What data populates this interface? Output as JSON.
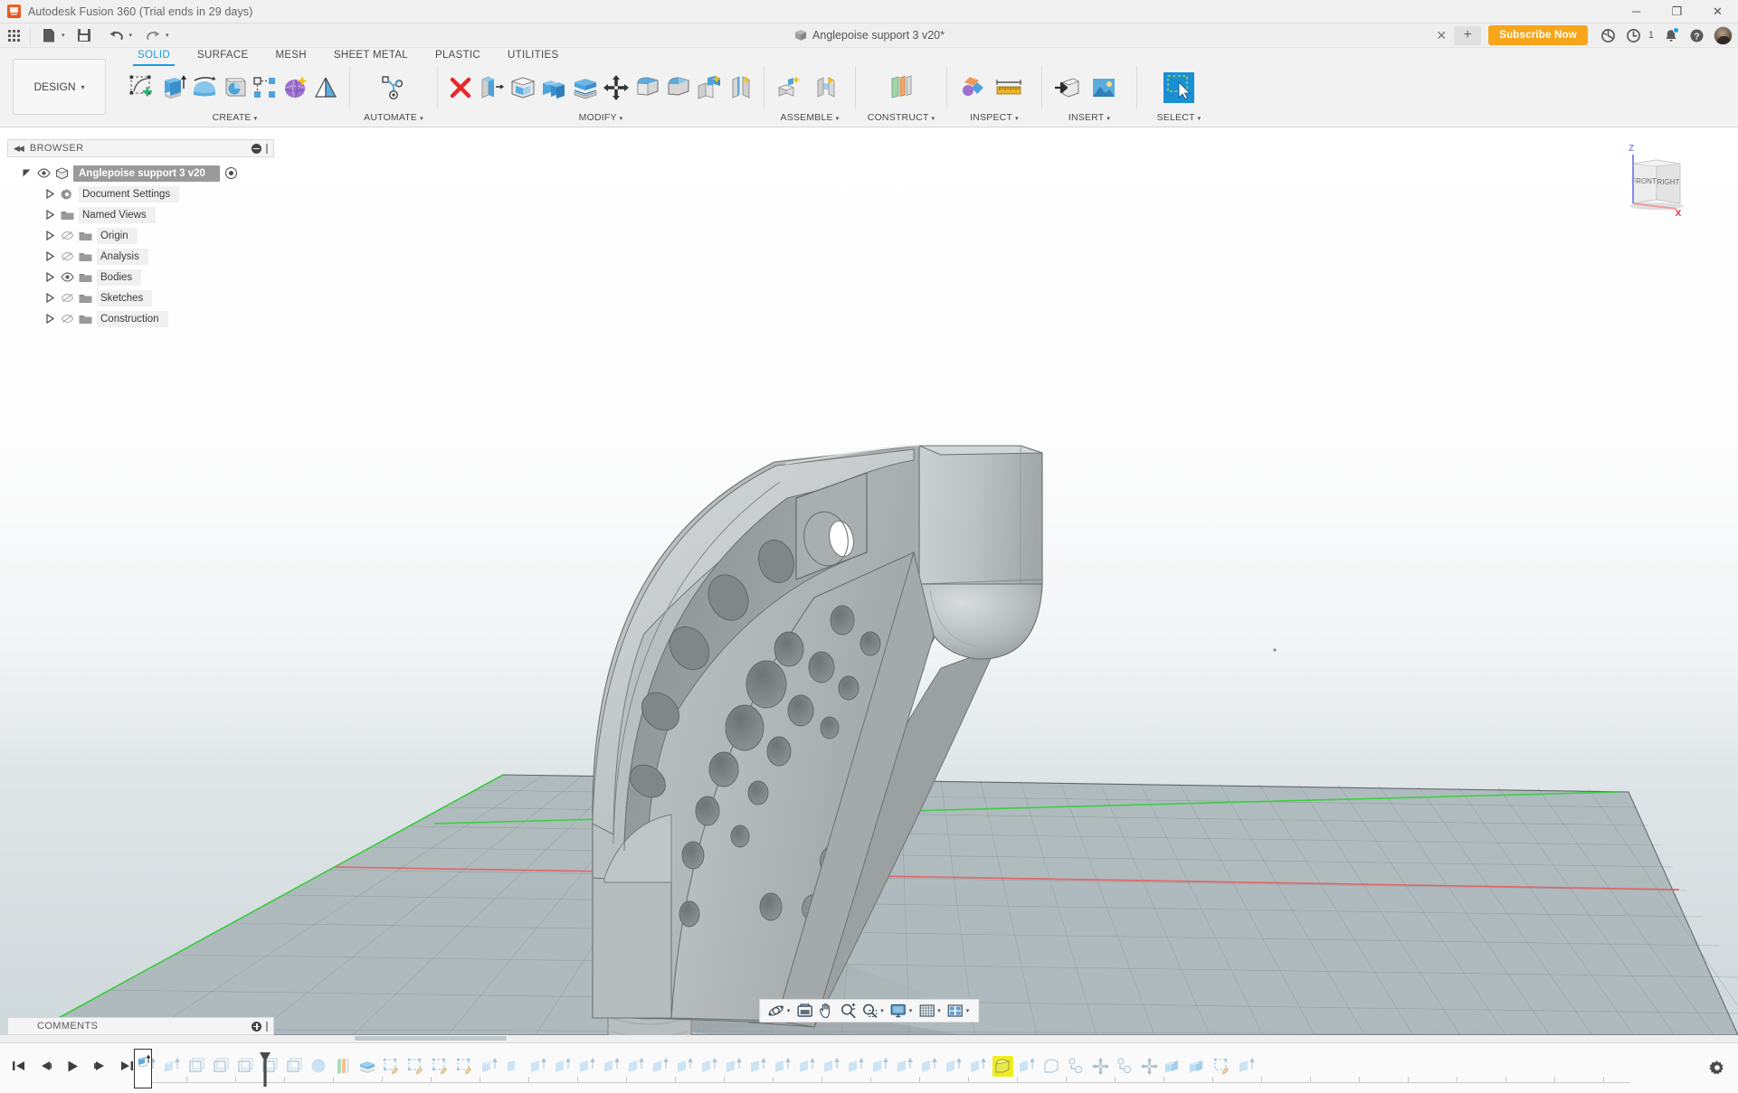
{
  "window": {
    "title": "Autodesk Fusion 360 (Trial ends in 29 days)",
    "app_icon": "fusion-logo-icon",
    "minimize": "─",
    "maximize": "❐",
    "close": "✕"
  },
  "quick_access": {
    "app_grid": "app-grid-icon",
    "file": "file-icon",
    "save": "save-icon",
    "undo": "undo-icon",
    "redo": "redo-icon",
    "caret": "▾"
  },
  "document_tab": {
    "icon": "cube-icon",
    "label": "Anglepoise support 3 v20*",
    "close": "✕",
    "new_tab": "+"
  },
  "header_right": {
    "subscribe_label": "Subscribe Now",
    "subscribe_color": "#f7a61b",
    "refresh_icon": "sync-icon",
    "job_status_icon": "clock-icon",
    "job_count": "1",
    "notifications_icon": "bell-icon",
    "help_icon": "help-icon",
    "avatar": "user-avatar"
  },
  "ribbon": {
    "design_label": "DESIGN",
    "design_caret": "▾",
    "tabs": [
      {
        "label": "SOLID",
        "active": true
      },
      {
        "label": "SURFACE",
        "active": false
      },
      {
        "label": "MESH",
        "active": false
      },
      {
        "label": "SHEET METAL",
        "active": false
      },
      {
        "label": "PLASTIC",
        "active": false
      },
      {
        "label": "UTILITIES",
        "active": false
      }
    ],
    "active_tab_color": "#1a9fe0",
    "groups": [
      {
        "label": "CREATE",
        "caret": "▾",
        "commands": [
          "new-sketch-icon",
          "extrude-icon",
          "revolve-icon",
          "sweep-icon",
          "rectangular-pattern-icon",
          "create-form-icon",
          "rib-icon"
        ]
      },
      {
        "label": "AUTOMATE",
        "caret": "▾",
        "commands": [
          "automated-modeling-icon"
        ]
      },
      {
        "label": "MODIFY",
        "caret": "▾",
        "commands": [
          "delete-icon",
          "press-pull-icon",
          "shell-icon",
          "combine-icon",
          "offset-face-icon",
          "move-copy-icon",
          "fillet-icon",
          "chamfer-icon",
          "draft-icon",
          "split-face-icon"
        ]
      },
      {
        "label": "ASSEMBLE",
        "caret": "▾",
        "commands": [
          "new-component-icon",
          "joint-icon"
        ]
      },
      {
        "label": "CONSTRUCT",
        "caret": "▾",
        "commands": [
          "offset-plane-icon"
        ]
      },
      {
        "label": "INSPECT",
        "caret": "▾",
        "commands": [
          "section-analysis-icon",
          "measure-icon"
        ]
      },
      {
        "label": "INSERT",
        "caret": "▾",
        "commands": [
          "insert-derive-icon",
          "insert-canvas-icon"
        ]
      },
      {
        "label": "SELECT",
        "caret": "▾",
        "commands": [
          "select-window-icon"
        ]
      }
    ]
  },
  "browser": {
    "panel_title": "BROWSER",
    "collapse_icon": "collapse-left-icon",
    "options_icon": "panel-options-icon",
    "root": {
      "label": "Anglepoise support 3 v20",
      "icon": "cube-icon",
      "eye": "eye-visible-icon",
      "twist": "twist-open-icon",
      "radio": "active-component-radio",
      "selected": true
    },
    "items": [
      {
        "label": "Document Settings",
        "icon": "gear-icon",
        "eye": "none",
        "twist": "twist-closed-icon"
      },
      {
        "label": "Named Views",
        "icon": "folder-icon",
        "eye": "none",
        "twist": "twist-closed-icon"
      },
      {
        "label": "Origin",
        "icon": "folder-icon",
        "eye": "eye-hidden-icon",
        "twist": "twist-closed-icon"
      },
      {
        "label": "Analysis",
        "icon": "folder-icon",
        "eye": "eye-hidden-icon",
        "twist": "twist-closed-icon"
      },
      {
        "label": "Bodies",
        "icon": "folder-icon",
        "eye": "eye-visible-icon",
        "twist": "twist-closed-icon"
      },
      {
        "label": "Sketches",
        "icon": "folder-icon",
        "eye": "eye-hidden-icon",
        "twist": "twist-closed-icon"
      },
      {
        "label": "Construction",
        "icon": "folder-icon",
        "eye": "eye-hidden-icon",
        "twist": "twist-closed-icon"
      }
    ]
  },
  "viewcube": {
    "front_label": "FRONT",
    "right_label": "RIGHT",
    "z_label": "Z",
    "x_label": "X",
    "z_color": "#7b7bf0",
    "x_color": "#e03838"
  },
  "viewport": {
    "model_name": "Anglepoise support bracket",
    "model_color": "#b8bdbd",
    "grid_line_color": "#8d9a9e",
    "x_axis_color": "#e06a6a",
    "y_axis_color": "#4cd24c",
    "background_top": "#ffffff",
    "background_bottom": "#cfd8db"
  },
  "navigation_bar": {
    "buttons": [
      {
        "name": "orbit-icon",
        "caret": "▾"
      },
      {
        "name": "look-at-icon",
        "caret": ""
      },
      {
        "name": "pan-icon",
        "caret": ""
      },
      {
        "name": "zoom-icon",
        "caret": ""
      },
      {
        "name": "fit-icon",
        "caret": "▾"
      },
      {
        "name": "display-settings-icon",
        "caret": "▾"
      },
      {
        "name": "grid-snaps-icon",
        "caret": "▾"
      },
      {
        "name": "viewports-icon",
        "caret": "▾"
      }
    ]
  },
  "comments": {
    "panel_title": "COMMENTS",
    "add_icon": "add-comment-icon"
  },
  "timeline": {
    "playback": [
      "jump-to-beginning-icon",
      "step-back-icon",
      "play-icon",
      "step-forward-icon",
      "jump-to-end-icon"
    ],
    "marker": "timeline-playhead",
    "settings_icon": "timeline-settings-gear-icon",
    "features": [
      {
        "icon": "extrude-icon",
        "state": "done"
      },
      {
        "icon": "extrude-icon",
        "state": "pending"
      },
      {
        "icon": "extrude-icon",
        "state": "pending"
      },
      {
        "icon": "sketch-icon",
        "state": "pending"
      },
      {
        "icon": "sketch-icon",
        "state": "pending"
      },
      {
        "icon": "sketch-icon",
        "state": "pending"
      },
      {
        "icon": "sketch-icon",
        "state": "pending"
      },
      {
        "icon": "sketch-icon",
        "state": "pending"
      },
      {
        "icon": "revolve-icon",
        "state": "pending"
      },
      {
        "icon": "plane-icon",
        "state": "pending"
      },
      {
        "icon": "shell-icon",
        "state": "pending"
      },
      {
        "icon": "sketch-edit-icon",
        "state": "pending"
      },
      {
        "icon": "sketch-edit-icon",
        "state": "pending"
      },
      {
        "icon": "sketch-edit-icon",
        "state": "pending"
      },
      {
        "icon": "sketch-edit-icon",
        "state": "pending"
      },
      {
        "icon": "extrude-icon",
        "state": "pending"
      },
      {
        "icon": "extrude-icon",
        "state": "pending"
      },
      {
        "icon": "extrude-icon",
        "state": "pending"
      },
      {
        "icon": "extrude-icon",
        "state": "pending"
      },
      {
        "icon": "extrude-icon",
        "state": "pending"
      },
      {
        "icon": "extrude-icon",
        "state": "pending"
      },
      {
        "icon": "extrude-icon",
        "state": "pending"
      },
      {
        "icon": "extrude-icon",
        "state": "pending"
      },
      {
        "icon": "extrude-icon",
        "state": "pending"
      },
      {
        "icon": "extrude-icon",
        "state": "pending"
      },
      {
        "icon": "extrude-icon",
        "state": "pending"
      },
      {
        "icon": "extrude-icon",
        "state": "pending"
      },
      {
        "icon": "extrude-icon",
        "state": "pending"
      },
      {
        "icon": "extrude-icon",
        "state": "pending"
      },
      {
        "icon": "extrude-icon",
        "state": "pending"
      },
      {
        "icon": "extrude-icon",
        "state": "pending"
      },
      {
        "icon": "extrude-icon",
        "state": "pending"
      },
      {
        "icon": "extrude-icon",
        "state": "pending"
      },
      {
        "icon": "extrude-icon",
        "state": "pending"
      },
      {
        "icon": "extrude-icon",
        "state": "pending"
      },
      {
        "icon": "fillet-icon",
        "state": "selected"
      },
      {
        "icon": "extrude-icon",
        "state": "pending"
      },
      {
        "icon": "fillet-icon",
        "state": "pending"
      },
      {
        "icon": "hole-icon",
        "state": "pending"
      },
      {
        "icon": "move-icon",
        "state": "pending"
      },
      {
        "icon": "hole-icon",
        "state": "pending"
      },
      {
        "icon": "move-icon",
        "state": "pending"
      },
      {
        "icon": "combine-icon",
        "state": "pending"
      },
      {
        "icon": "combine-icon",
        "state": "pending"
      },
      {
        "icon": "sketch-edit-icon",
        "state": "pending"
      },
      {
        "icon": "extrude-icon",
        "state": "pending"
      },
      {
        "icon": "extrude-icon",
        "state": "pending"
      },
      {
        "icon": "sketch-edit-icon",
        "state": "pending"
      },
      {
        "icon": "extrude-icon",
        "state": "pending"
      }
    ],
    "selected_color": "#eded1f"
  }
}
